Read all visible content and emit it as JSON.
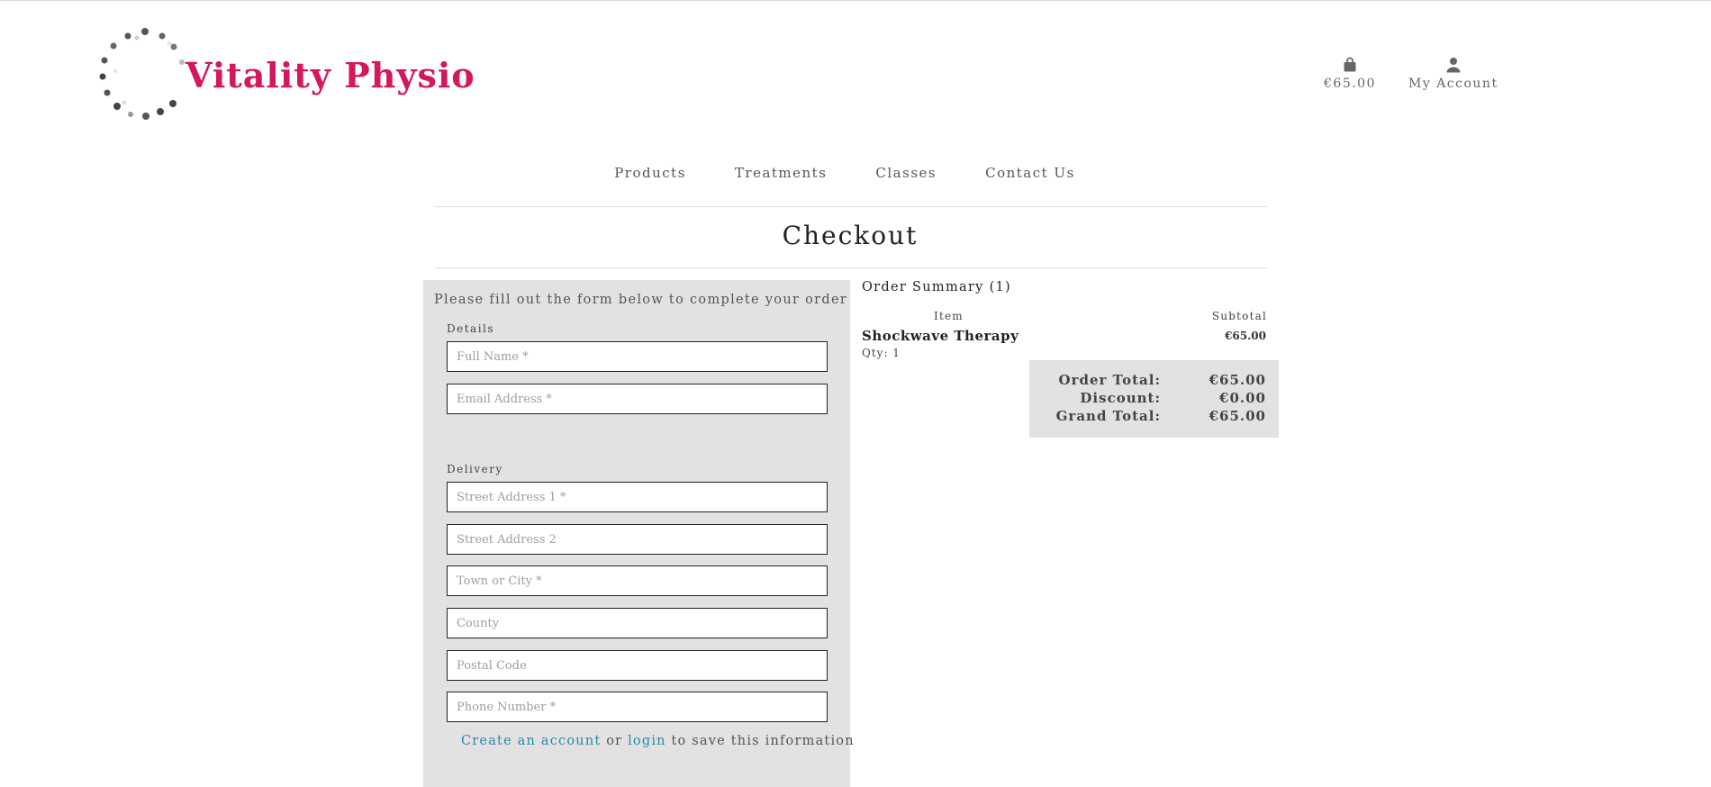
{
  "brand": {
    "name": "Vitality Physio"
  },
  "header": {
    "bag": {
      "icon": "shopping-bag-icon",
      "total": "€65.00"
    },
    "account": {
      "icon": "user-icon",
      "label": "My Account"
    }
  },
  "nav": {
    "items": [
      "Products",
      "Treatments",
      "Classes",
      "Contact Us"
    ]
  },
  "page": {
    "title": "Checkout"
  },
  "form": {
    "intro": "Please fill out the form below to complete your order",
    "details_label": "Details",
    "delivery_label": "Delivery",
    "fields": {
      "full_name": "Full Name *",
      "email": "Email Address *",
      "street1": "Street Address 1 *",
      "street2": "Street Address 2",
      "town": "Town or City *",
      "county": "County",
      "postcode": "Postal Code",
      "phone": "Phone Number *"
    },
    "save_info": {
      "create": "Create an account",
      "or": "or",
      "login": "login",
      "suffix": "to save this information"
    }
  },
  "summary": {
    "title": "Order Summary (1)",
    "col_item": "Item",
    "col_subtotal": "Subtotal",
    "items": [
      {
        "name": "Shockwave Therapy",
        "qty": "Qty: 1",
        "subtotal": "€65.00"
      }
    ],
    "totals": {
      "order_total_label": "Order Total:",
      "order_total": "€65.00",
      "discount_label": "Discount:",
      "discount": "€0.00",
      "grand_total_label": "Grand Total:",
      "grand_total": "€65.00"
    }
  },
  "colors": {
    "brand": "#d3185f",
    "link": "#1f8ea8",
    "panel": "#e3e1e1"
  }
}
